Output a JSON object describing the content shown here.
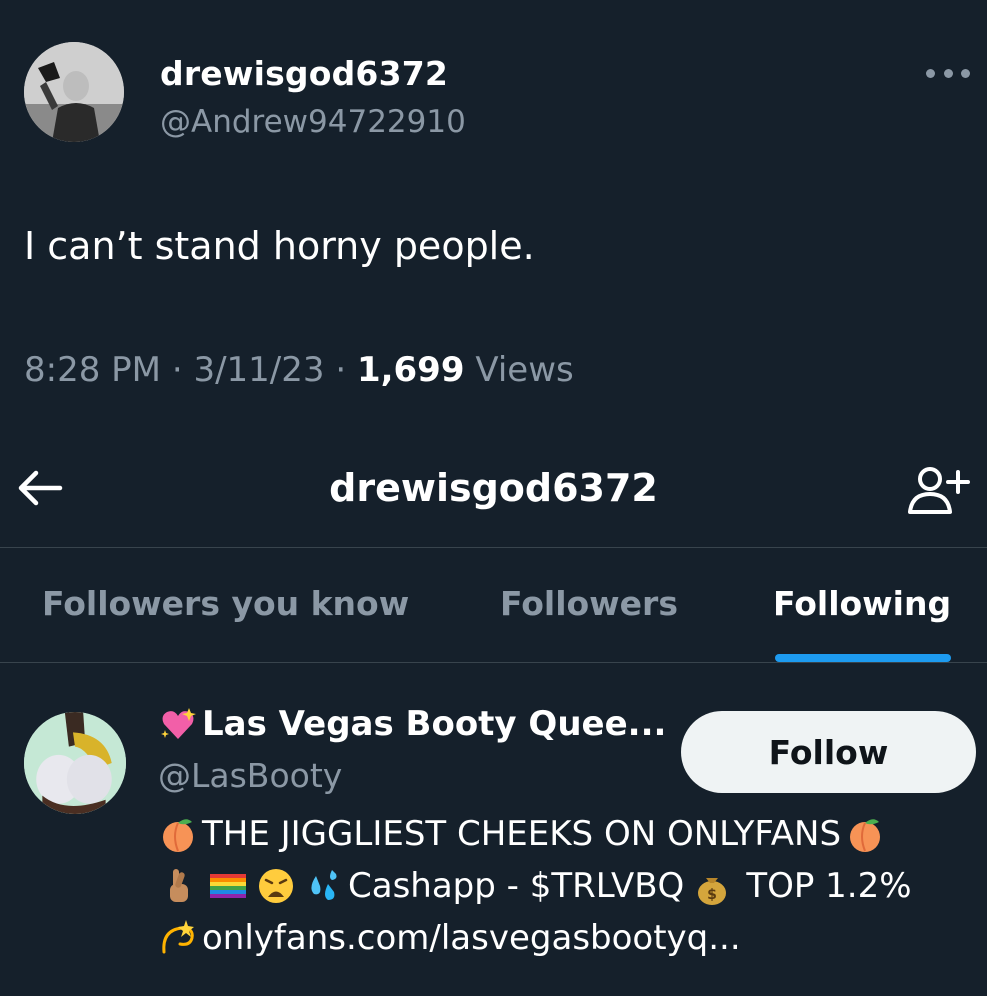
{
  "tweet": {
    "display_name": "drewisgod6372",
    "handle": "@Andrew94722910",
    "text": "I can’t stand horny people.",
    "time": "8:28 PM",
    "date": "3/11/23",
    "views_count": "1,699",
    "views_label": "Views",
    "sep": "·"
  },
  "header": {
    "title": "drewisgod6372"
  },
  "tabs": [
    {
      "label": "Followers you know"
    },
    {
      "label": "Followers"
    },
    {
      "label": "Following"
    }
  ],
  "user": {
    "name": "Las Vegas Booty Quee...",
    "handle": "@LasBooty",
    "follow_label": "Follow",
    "bio_line1": "THE JIGGLIEST CHEEKS ON ONLYFANS",
    "bio_cashapp": "Cashapp - $TRLVBQ",
    "bio_top": "TOP 1.2%",
    "bio_link": "onlyfans.com/lasvegasbootyq..."
  },
  "colors": {
    "background": "#15202b",
    "accent": "#1d9bf0",
    "secondary_text": "#8b98a5",
    "divider": "#38444d"
  },
  "icons": [
    "more-icon",
    "back-arrow-icon",
    "add-user-icon",
    "sparkling-heart-emoji",
    "peach-emoji",
    "crossed-fingers-emoji",
    "rainbow-flag-emoji",
    "weary-face-emoji",
    "sweat-droplets-emoji",
    "money-bag-emoji",
    "dizzy-emoji"
  ]
}
